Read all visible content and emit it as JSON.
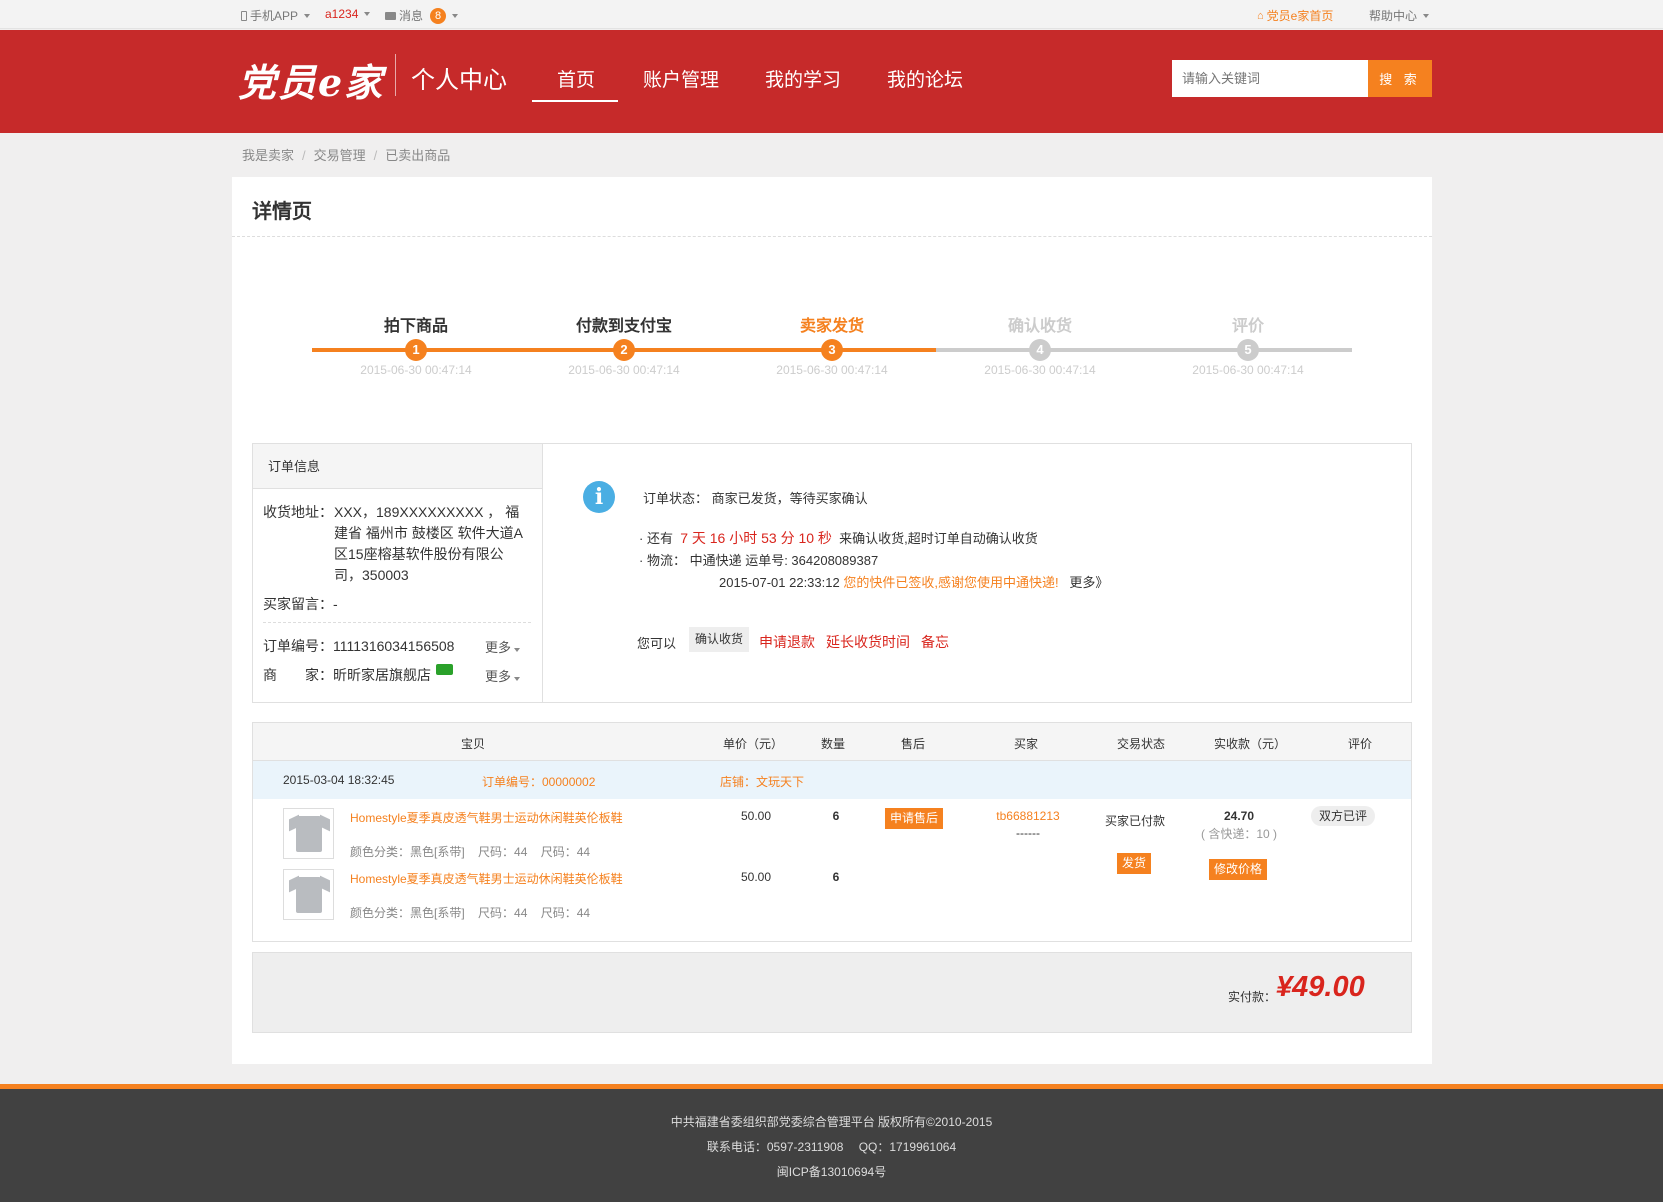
{
  "topbar": {
    "mobile_app": "手机APP",
    "username": "a1234",
    "messages_label": "消息",
    "messages_count": "8",
    "home_link": "党员e家首页",
    "help_center": "帮助中心"
  },
  "header": {
    "logo": "党员e家",
    "subtitle": "个人中心",
    "nav": [
      "首页",
      "账户管理",
      "我的学习",
      "我的论坛"
    ],
    "search_placeholder": "请输入关键词",
    "search_button": "搜 索"
  },
  "breadcrumb": [
    "我是卖家",
    "交易管理",
    "已卖出商品"
  ],
  "page_title": "详情页",
  "steps": [
    {
      "label": "拍下商品",
      "num": "1",
      "date": "2015-06-30 00:47:14",
      "state": "done"
    },
    {
      "label": "付款到支付宝",
      "num": "2",
      "date": "2015-06-30 00:47:14",
      "state": "done"
    },
    {
      "label": "卖家发货",
      "num": "3",
      "date": "2015-06-30 00:47:14",
      "state": "current"
    },
    {
      "label": "确认收货",
      "num": "4",
      "date": "2015-06-30 00:47:14",
      "state": "todo"
    },
    {
      "label": "评价",
      "num": "5",
      "date": "2015-06-30 00:47:14",
      "state": "todo"
    }
  ],
  "order_info": {
    "title": "订单信息",
    "address_label": "收货地址：",
    "address": "XXX，189XXXXXXXXX ， 福建省 福州市 鼓楼区 软件大道A区15座榕基软件股份有限公司，350003",
    "buyer_message_label": "买家留言：",
    "buyer_message": "-",
    "order_no_label": "订单编号：",
    "order_no": "1111316034156508",
    "seller_label": "商　　家：",
    "seller": "昕昕家居旗舰店",
    "more": "更多"
  },
  "status": {
    "icon": "info-icon",
    "label": "订单状态：",
    "text": "商家已发货，等待买家确认",
    "countdown_prefix": "还有",
    "countdown": "7 天 16 小时 53 分 10 秒",
    "countdown_suffix": "来确认收货,超时订单自动确认收货",
    "logistics_label": "物流：",
    "logistics": "中通快递 运单号: 364208089387",
    "logistics_time": "2015-07-01 22:33:12",
    "logistics_msg": "您的快件已签收,感谢您使用中通快递!",
    "logistics_more": "更多》",
    "actions_label": "您可以",
    "confirm_button": "确认收货",
    "links": [
      "申请退款",
      "延长收货时间",
      "备忘"
    ]
  },
  "table": {
    "headers": [
      "宝贝",
      "单价（元）",
      "数量",
      "售后",
      "买家",
      "交易状态",
      "实收款（元）",
      "评价"
    ],
    "order_date": "2015-03-04 18:32:45",
    "order_no_text": "订单编号：00000002",
    "shop_text": "店铺：文玩天下",
    "items": [
      {
        "name": "Homestyle夏季真皮透气鞋男士运动休闲鞋英伦板鞋",
        "color": "颜色分类：黑色[系带]",
        "size1": "尺码：44",
        "size2": "尺码：44",
        "price": "50.00",
        "qty": "6"
      },
      {
        "name": "Homestyle夏季真皮透气鞋男士运动休闲鞋英伦板鞋",
        "color": "颜色分类：黑色[系带]",
        "size1": "尺码：44",
        "size2": "尺码：44",
        "price": "50.00",
        "qty": "6"
      }
    ],
    "aftersale_button": "申请售后",
    "buyer": "tb66881213",
    "buyer_sub": "------",
    "trade_status": "买家已付款",
    "ship_button": "发货",
    "received": "24.70",
    "shipping_note": "( 含快递：10 )",
    "modify_price_button": "修改价格",
    "review": "双方已评"
  },
  "paid": {
    "label": "实付款：",
    "amount": "¥49.00"
  },
  "footer": {
    "line1": "中共福建省委组织部党委综合管理平台 版权所有©2010-2015",
    "line2": "联系电话：0597-2311908　 QQ：1719961064",
    "line3": "闽ICP备13010694号"
  },
  "colors": {
    "brand_red": "#c62a2a",
    "accent_orange": "#f5811f",
    "price_red": "#d9251d"
  }
}
